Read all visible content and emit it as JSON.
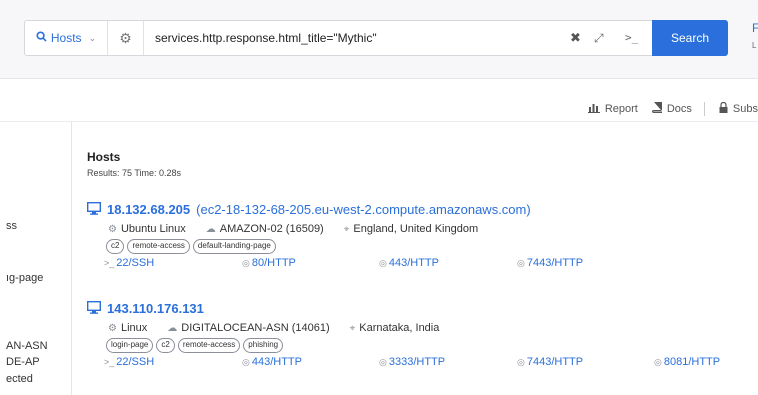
{
  "search": {
    "type_label": "Hosts",
    "query": "services.http.response.html_title=\"Mythic\"",
    "button_label": "Search",
    "cut_right_top": "F",
    "cut_right_bottom": "L"
  },
  "toolbar": {
    "report_label": "Report",
    "docs_label": "Docs",
    "subs_label": "Subs"
  },
  "sidebar": {
    "items": [
      "ss",
      "ıg-page",
      "AN-ASN",
      "DE-AP",
      "ected"
    ]
  },
  "results": {
    "title": "Hosts",
    "meta": "Results: 75   Time: 0.28s",
    "hosts": [
      {
        "ip": "18.132.68.205",
        "dns": "(ec2-18-132-68-205.eu-west-2.compute.amazonaws.com)",
        "os": "Ubuntu Linux",
        "asn": "AMAZON-02 (16509)",
        "location": "England, United Kingdom",
        "tags": [
          "c2",
          "remote-access",
          "default-landing-page"
        ],
        "services": [
          "22/SSH",
          "80/HTTP",
          "443/HTTP",
          "7443/HTTP"
        ]
      },
      {
        "ip": "143.110.176.131",
        "dns": "",
        "os": "Linux",
        "asn": "DIGITALOCEAN-ASN (14061)",
        "location": "Karnataka, India",
        "tags": [
          "login-page",
          "c2",
          "remote-access",
          "phishing"
        ],
        "services": [
          "22/SSH",
          "443/HTTP",
          "3333/HTTP",
          "7443/HTTP",
          "8081/HTTP"
        ]
      }
    ]
  },
  "colors": {
    "accent": "#2a6fdb",
    "muted": "#8a8f99"
  }
}
